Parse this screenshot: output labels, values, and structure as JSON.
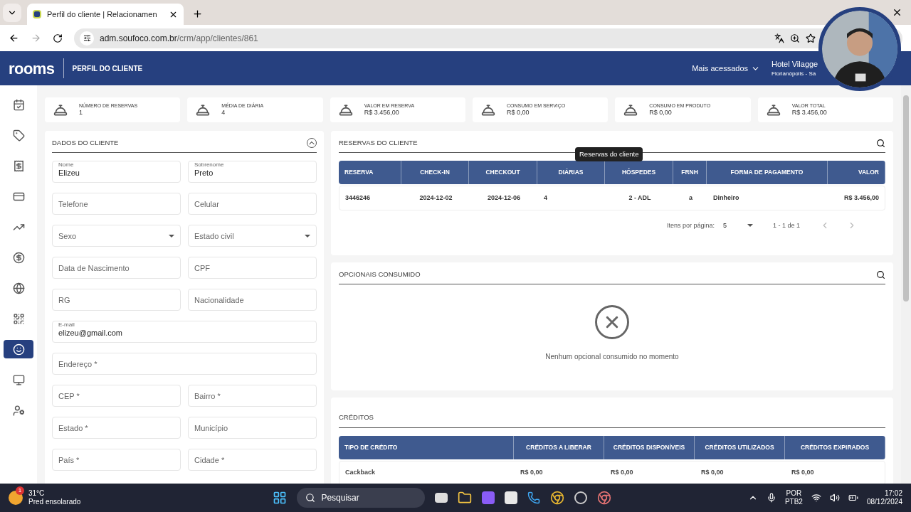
{
  "browser": {
    "tab": {
      "title": "Perfil do cliente | Relacionamen",
      "selected": true
    },
    "url_host": "adm.soufoco.com.br",
    "url_path": "/crm/app/clientes/861"
  },
  "header": {
    "logo": "rooms",
    "title": "PERFIL DO CLIENTE",
    "menu": "Mais acessados",
    "hotel": "Hotel Vilagge",
    "location": "Florianópolis - Sa"
  },
  "sidebar": {
    "items": [
      {
        "kind": "calendar",
        "selected": false
      },
      {
        "kind": "tag",
        "selected": false
      },
      {
        "kind": "receipt",
        "selected": false
      },
      {
        "kind": "card",
        "selected": false
      },
      {
        "kind": "chart",
        "selected": false
      },
      {
        "kind": "dollar",
        "selected": false
      },
      {
        "kind": "globe",
        "selected": false
      },
      {
        "kind": "qr",
        "selected": false
      },
      {
        "kind": "smile",
        "selected": true
      },
      {
        "kind": "monitor",
        "selected": false
      },
      {
        "kind": "user_settings",
        "selected": false
      }
    ]
  },
  "stats": [
    {
      "label": "NÚMERO DE RESERVAS",
      "value": "1"
    },
    {
      "label": "MÉDIA DE DIÁRIA",
      "value": "4"
    },
    {
      "label": "VALOR EM RESERVA",
      "value": "R$ 3.456,00"
    },
    {
      "label": "CONSUMO EM SERVIÇO",
      "value": "R$ 0,00"
    },
    {
      "label": "CONSUMO EM PRODUTO",
      "value": "R$ 0,00"
    },
    {
      "label": "VALOR TOTAL",
      "value": "R$ 3.456,00"
    }
  ],
  "client": {
    "title": "DADOS DO CLIENTE",
    "rows": [
      [
        {
          "kind": "text",
          "label": "Nome",
          "value": "Elizeu"
        },
        {
          "kind": "text",
          "label": "Sobrenome",
          "value": "Preto"
        }
      ],
      [
        {
          "kind": "text",
          "placeholder": "Telefone"
        },
        {
          "kind": "text",
          "placeholder": "Celular"
        }
      ],
      [
        {
          "kind": "select",
          "placeholder": "Sexo"
        },
        {
          "kind": "select",
          "placeholder": "Estado civil"
        }
      ],
      [
        {
          "kind": "text",
          "placeholder": "Data de Nascimento"
        },
        {
          "kind": "text",
          "placeholder": "CPF"
        }
      ],
      [
        {
          "kind": "text",
          "placeholder": "RG"
        },
        {
          "kind": "text",
          "placeholder": "Nacionalidade"
        }
      ],
      [
        {
          "kind": "text",
          "label": "E-mail",
          "value": "elizeu@gmail.com"
        }
      ],
      [
        {
          "kind": "text",
          "placeholder": "Endereço *"
        }
      ],
      [
        {
          "kind": "text",
          "placeholder": "CEP *"
        },
        {
          "kind": "text",
          "placeholder": "Bairro *"
        }
      ],
      [
        {
          "kind": "text",
          "placeholder": "Estado *"
        },
        {
          "kind": "text",
          "placeholder": "Município"
        }
      ],
      [
        {
          "kind": "text",
          "placeholder": "País *"
        },
        {
          "kind": "text",
          "placeholder": "Cidade *"
        }
      ]
    ]
  },
  "reservations": {
    "title": "RESERVAS DO CLIENTE",
    "tooltip": "Reservas do cliente",
    "columns": [
      "RESERVA",
      "CHECK-IN",
      "CHECKOUT",
      "DIÁRIAS",
      "HÓSPEDES",
      "FRNH",
      "FORMA DE PAGAMENTO",
      "VALOR"
    ],
    "rows": [
      [
        "3446246",
        "2024-12-02",
        "2024-12-06",
        "4",
        "2 - ADL",
        "a",
        "Dinheiro",
        "R$ 3.456,00"
      ]
    ],
    "per_page_label": "Itens por página:",
    "per_page": "5",
    "range": "1 - 1 de 1"
  },
  "optionals": {
    "title": "OPCIONAIS CONSUMIDO",
    "empty_message": "Nenhum opcional consumido no momento"
  },
  "credits": {
    "title": "CRÉDITOS",
    "columns": [
      "TIPO DE CRÉDITO",
      "CRÉDITOS A LIBERAR",
      "CRÉDITOS DISPONÍVEIS",
      "CRÉDITOS UTILIZADOS",
      "CRÉDITOS EXPIRADOS"
    ],
    "rows": [
      [
        "Cackback",
        "R$ 0,00",
        "R$ 0,00",
        "R$ 0,00",
        "R$ 0,00"
      ]
    ]
  },
  "taskbar": {
    "weather_badge": "1",
    "temperature": "31°C",
    "weather": "Pred ensolarado",
    "search": "Pesquisar",
    "language": "POR",
    "layout": "PTB2",
    "time": "17:02",
    "date": "08/12/2024"
  }
}
